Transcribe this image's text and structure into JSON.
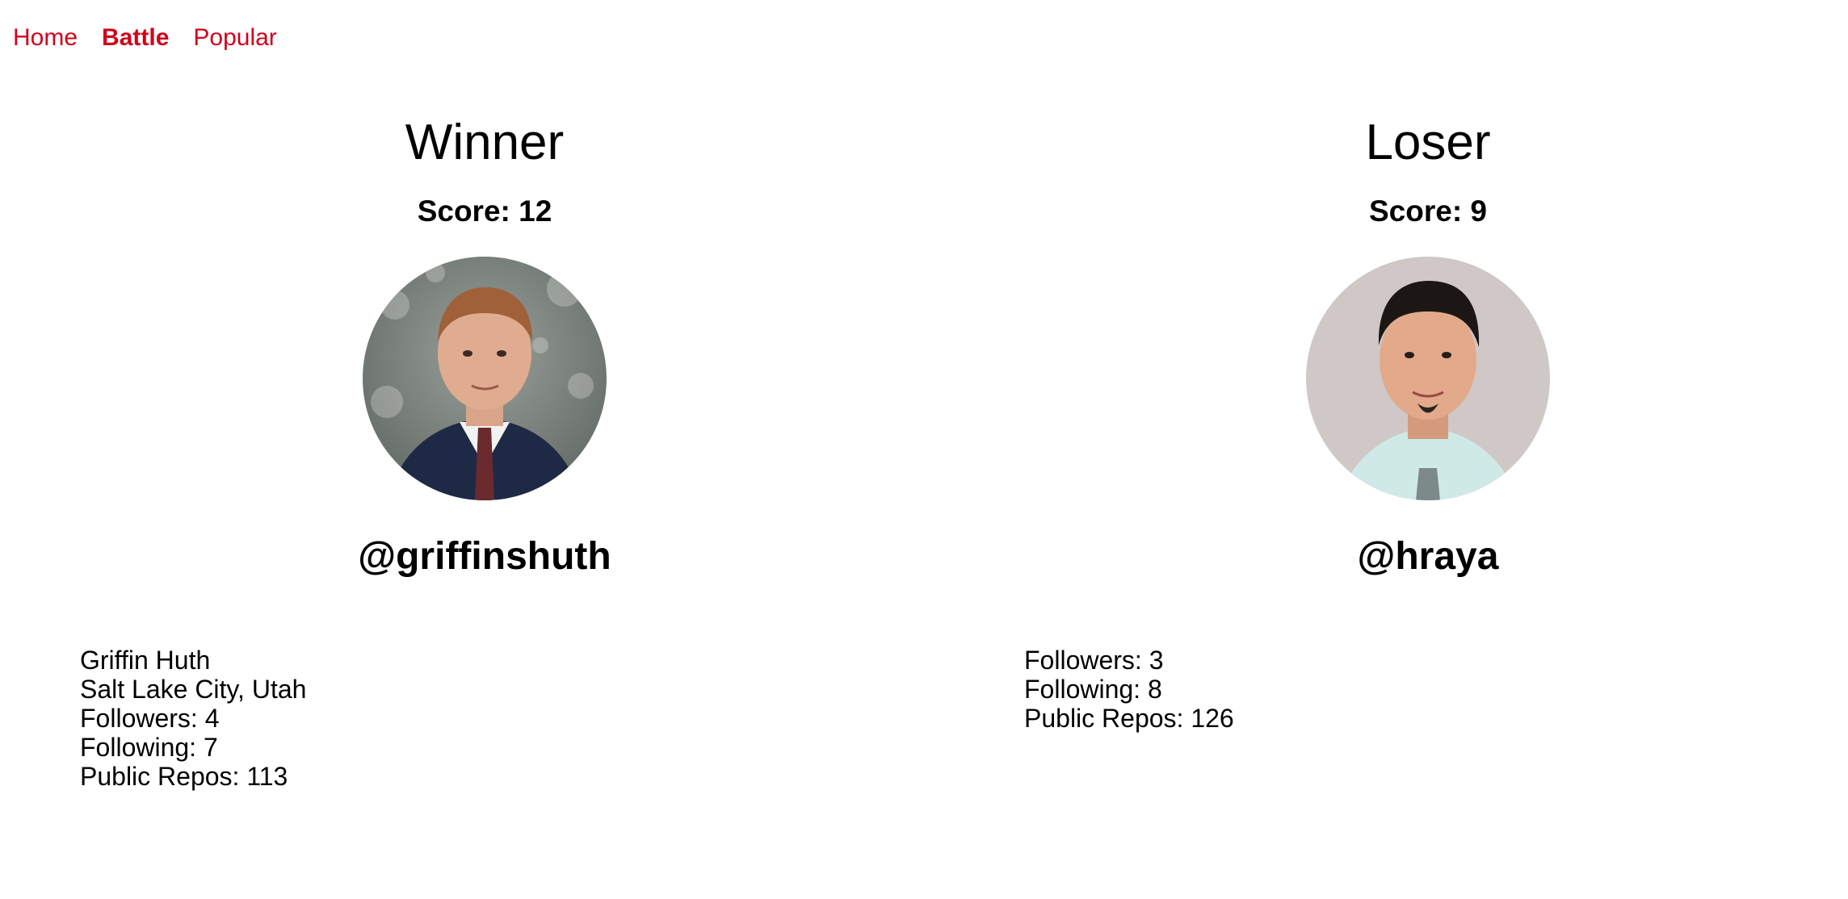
{
  "nav": {
    "items": [
      {
        "label": "Home",
        "active": false
      },
      {
        "label": "Battle",
        "active": true
      },
      {
        "label": "Popular",
        "active": false
      }
    ],
    "color": "#d0021b"
  },
  "winner": {
    "heading": "Winner",
    "score": "Score: 12",
    "username": "@griffinshuth",
    "details": {
      "name": "Griffin Huth",
      "location": "Salt Lake City, Utah",
      "followers": "Followers: 4",
      "following": "Following: 7",
      "repos": "Public Repos: 113"
    }
  },
  "loser": {
    "heading": "Loser",
    "score": "Score: 9",
    "username": "@hraya",
    "details": {
      "followers": "Followers: 3",
      "following": "Following: 8",
      "repos": "Public Repos: 126"
    }
  }
}
